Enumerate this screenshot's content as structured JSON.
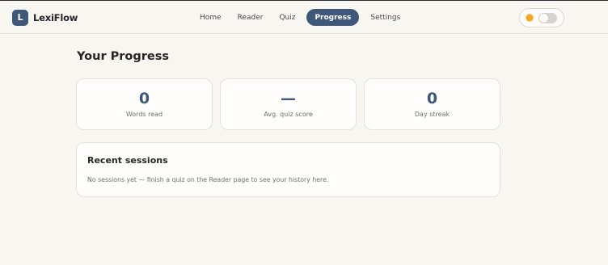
{
  "app": {
    "logo_letter": "L",
    "name": "LexiFlow"
  },
  "nav": {
    "items": [
      {
        "label": "Home",
        "active": false
      },
      {
        "label": "Reader",
        "active": false
      },
      {
        "label": "Quiz",
        "active": false
      },
      {
        "label": "Progress",
        "active": true
      },
      {
        "label": "Settings",
        "active": false
      }
    ]
  },
  "theme_toggle": {
    "icon": "sun-icon",
    "state": "off"
  },
  "page": {
    "title": "Your Progress"
  },
  "stats": [
    {
      "value": "0",
      "label": "Words read"
    },
    {
      "value": "—",
      "label": "Avg. quiz score"
    },
    {
      "value": "0",
      "label": "Day streak"
    }
  ],
  "sessions": {
    "title": "Recent sessions",
    "empty_text": "No sessions yet — finish a quiz on the Reader page to see your history here."
  },
  "colors": {
    "accent": "#3f5879",
    "background": "#f8f6f1",
    "sun": "#f2a526"
  }
}
